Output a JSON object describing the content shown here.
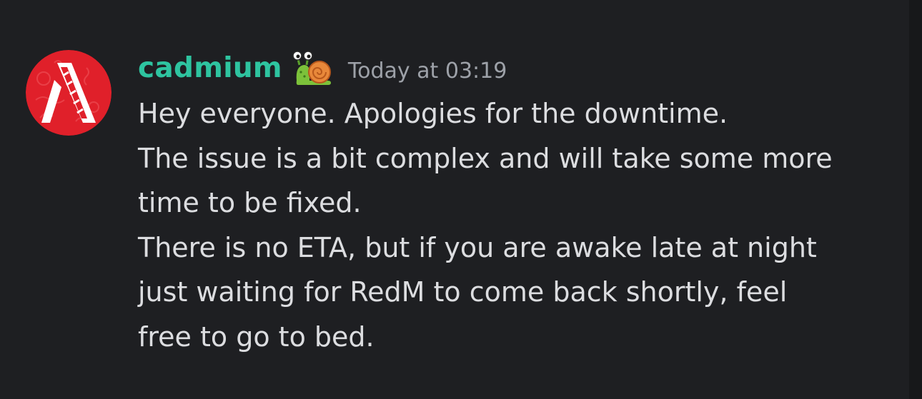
{
  "message": {
    "author": "cadmium",
    "timestamp": "Today at 03:19",
    "badge_icon": "snail-icon",
    "colors": {
      "background": "#1e1f22",
      "username": "#2ec4a0",
      "timestamp": "#9da1a8",
      "text": "#dcdde0",
      "avatar": "#e0202a"
    },
    "lines": [
      "Hey everyone. Apologies for the downtime.",
      "The issue is a bit complex and will take some more",
      "time to be fixed.",
      "There is no ETA, but if you are awake late at night",
      "just waiting for RedM to come back shortly, feel",
      "free to go to bed."
    ]
  }
}
